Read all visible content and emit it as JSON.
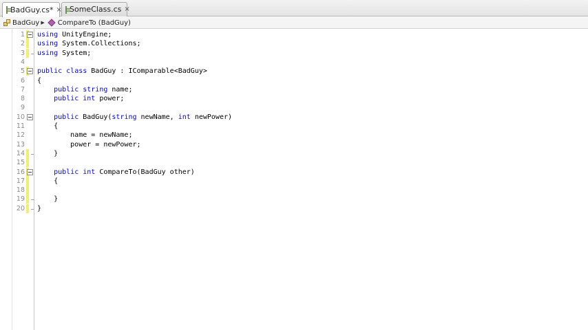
{
  "tabs": [
    {
      "label": "BadGuy.cs*",
      "close": "×"
    },
    {
      "label": "SomeClass.cs",
      "close": "×"
    }
  ],
  "breadcrumb": {
    "class": "BadGuy",
    "method": "CompareTo (BadGuy)"
  },
  "colors": {
    "keyword": "#0000ff",
    "changed_line_marker": "#f2ee6e",
    "line_number": "#8a8a8a"
  },
  "icons": [
    "file-icon",
    "close-icon",
    "class-icon",
    "method-icon",
    "fold-toggle-icon"
  ],
  "code": {
    "lines": [
      {
        "number": "1",
        "parts": [
          {
            "t": "using",
            "k": 1
          },
          {
            "t": " UnityEngine;"
          }
        ],
        "marker": true,
        "fold": "open"
      },
      {
        "number": "2",
        "parts": [
          {
            "t": "using",
            "k": 1
          },
          {
            "t": " System.Collections;"
          }
        ],
        "marker": true
      },
      {
        "number": "3",
        "parts": [
          {
            "t": "using",
            "k": 1
          },
          {
            "t": " System;"
          }
        ],
        "marker": true,
        "fold": "end"
      },
      {
        "number": "4",
        "parts": []
      },
      {
        "number": "5",
        "parts": [
          {
            "t": "public",
            "k": 1
          },
          {
            "t": " "
          },
          {
            "t": "class",
            "k": 1
          },
          {
            "t": " BadGuy : IComparable<BadGuy>"
          }
        ],
        "marker": true,
        "fold": "open"
      },
      {
        "number": "6",
        "parts": [
          {
            "t": "{"
          }
        ]
      },
      {
        "number": "7",
        "parts": [
          {
            "t": "    "
          },
          {
            "t": "public",
            "k": 1
          },
          {
            "t": " "
          },
          {
            "t": "string",
            "k": 1
          },
          {
            "t": " name;"
          }
        ]
      },
      {
        "number": "8",
        "parts": [
          {
            "t": "    "
          },
          {
            "t": "public",
            "k": 1
          },
          {
            "t": " "
          },
          {
            "t": "int",
            "k": 1
          },
          {
            "t": " power;"
          }
        ]
      },
      {
        "number": "9",
        "parts": []
      },
      {
        "number": "10",
        "parts": [
          {
            "t": "    "
          },
          {
            "t": "public",
            "k": 1
          },
          {
            "t": " BadGuy("
          },
          {
            "t": "string",
            "k": 1
          },
          {
            "t": " newName, "
          },
          {
            "t": "int",
            "k": 1
          },
          {
            "t": " newPower)"
          }
        ],
        "fold": "open"
      },
      {
        "number": "11",
        "parts": [
          {
            "t": "    {"
          }
        ]
      },
      {
        "number": "12",
        "parts": [
          {
            "t": "        name = newName;"
          }
        ]
      },
      {
        "number": "13",
        "parts": [
          {
            "t": "        power = newPower;"
          }
        ]
      },
      {
        "number": "14",
        "parts": [
          {
            "t": "    }"
          }
        ],
        "marker": true,
        "fold": "end"
      },
      {
        "number": "15",
        "parts": [],
        "marker": true
      },
      {
        "number": "16",
        "parts": [
          {
            "t": "    "
          },
          {
            "t": "public",
            "k": 1
          },
          {
            "t": " "
          },
          {
            "t": "int",
            "k": 1
          },
          {
            "t": " CompareTo(BadGuy other)"
          }
        ],
        "marker": true,
        "fold": "open"
      },
      {
        "number": "17",
        "parts": [
          {
            "t": "    {"
          }
        ],
        "marker": true
      },
      {
        "number": "18",
        "parts": [],
        "marker": true
      },
      {
        "number": "19",
        "parts": [
          {
            "t": "    }"
          }
        ],
        "marker": true,
        "fold": "end"
      },
      {
        "number": "20",
        "parts": [
          {
            "t": "}"
          }
        ],
        "marker": true,
        "fold": "end"
      }
    ]
  }
}
